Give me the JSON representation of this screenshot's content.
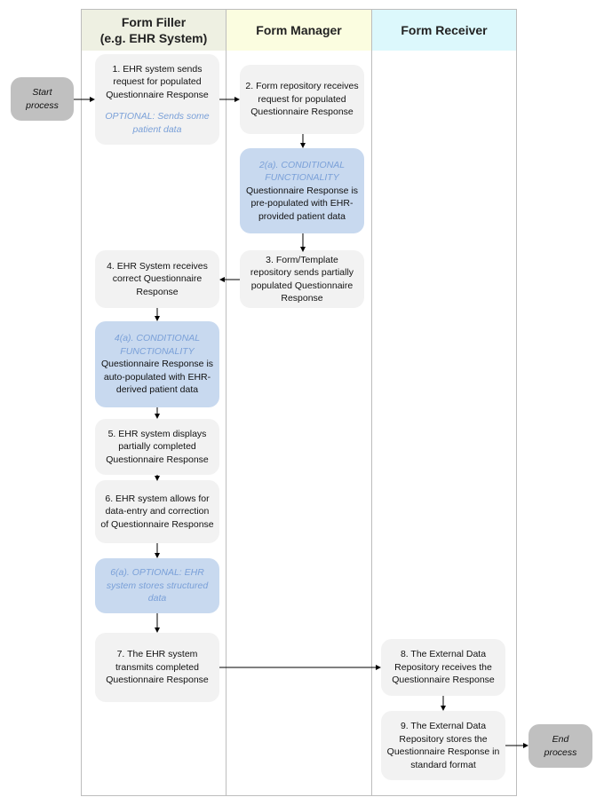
{
  "lanes": [
    {
      "id": "filler",
      "title": "Form Filler\n(e.g. EHR System)",
      "color": "#eef0e2"
    },
    {
      "id": "manager",
      "title": "Form Manager",
      "color": "#fbfde0"
    },
    {
      "id": "receiver",
      "title": "Form Receiver",
      "color": "#dcf8fc"
    }
  ],
  "terminals": {
    "start": "Start\nprocess",
    "end": "End\nprocess"
  },
  "steps": {
    "s1": {
      "main": "1. EHR system sends request for populated Questionnaire Response",
      "note": "OPTIONAL: Sends some patient data"
    },
    "s2": {
      "main": "2. Form repository receives request for populated Questionnaire Response"
    },
    "s2a": {
      "note": "2(a). CONDITIONAL FUNCTIONALITY",
      "main": "Questionnaire Response is pre-populated with EHR-provided patient data"
    },
    "s3": {
      "main": "3. Form/Template repository sends partially populated Questionnaire Response"
    },
    "s4": {
      "main": "4. EHR System receives correct Questionnaire Response"
    },
    "s4a": {
      "note": "4(a). CONDITIONAL FUNCTIONALITY",
      "main": "Questionnaire Response is auto-populated with EHR-derived patient data"
    },
    "s5": {
      "main": "5. EHR system displays partially completed Questionnaire Response"
    },
    "s6": {
      "main": "6. EHR system allows for data-entry and correction of Questionnaire Response"
    },
    "s6a": {
      "note": "6(a). OPTIONAL: EHR system stores structured data"
    },
    "s7": {
      "main": "7. The EHR system transmits completed Questionnaire Response"
    },
    "s8": {
      "main": "8. The External Data Repository receives the Questionnaire Response"
    },
    "s9": {
      "main": "9. The External Data Repository stores the Questionnaire Response in standard format"
    }
  },
  "colors": {
    "step_fill": "#f2f2f2",
    "conditional_fill": "#c8d9ef",
    "terminal_fill": "#c0c0c0",
    "note_text": "#7aa0d8",
    "lane_border": "#bdbdbd"
  }
}
